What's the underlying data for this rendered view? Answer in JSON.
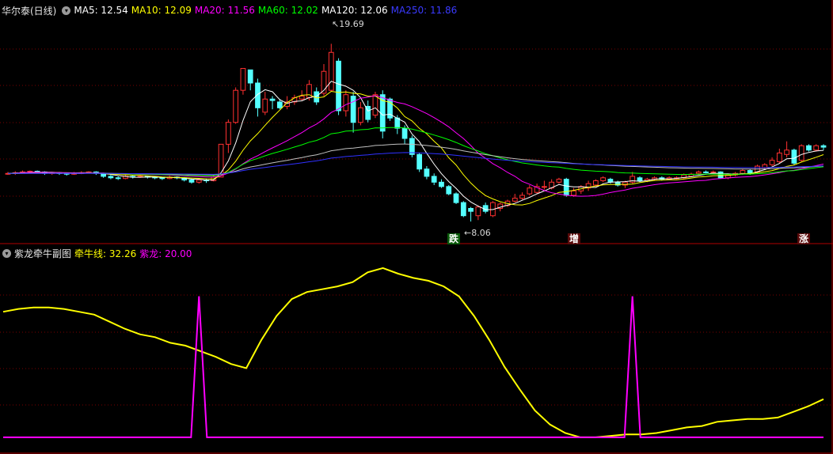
{
  "main_header": {
    "title": "华尔泰(日线)",
    "ma5": "MA5: 12.54",
    "ma10": "MA10: 12.09",
    "ma20": "MA20: 11.56",
    "ma60": "MA60: 12.02",
    "ma120": "MA120: 12.06",
    "ma250": "MA250: 11.86"
  },
  "sub_header": {
    "title": "紫龙牵牛副图",
    "qianniu": "牵牛线: 32.26",
    "zilong": "紫龙: 20.00"
  },
  "annotations": {
    "high": "19.69",
    "low": "8.06"
  },
  "signals": {
    "s1": "跌",
    "s2": "增",
    "s3": "涨"
  },
  "colors": {
    "ma5": "#ffffff",
    "ma10": "#ffff00",
    "ma20": "#ff00ff",
    "ma60": "#00ff00",
    "ma120": "#ffffff",
    "ma250": "#3030ff",
    "up": "#ff3030",
    "down": "#54ffff",
    "qianniu": "#ffff00",
    "zilong": "#ff00ff",
    "grid": "#7a0000"
  },
  "chart_data": [
    {
      "type": "candlestick",
      "series": [
        {
          "name": "MA5",
          "values": []
        },
        {
          "name": "MA10",
          "values": []
        },
        {
          "name": "MA20",
          "values": []
        },
        {
          "name": "MA60",
          "values": []
        },
        {
          "name": "MA120",
          "values": []
        },
        {
          "name": "MA250",
          "values": []
        }
      ],
      "annotations": [
        "19.69",
        "8.06"
      ],
      "ylim": [
        6.8,
        21.5
      ],
      "candles": [
        [
          10.8,
          10.8,
          10.9,
          10.7
        ],
        [
          10.8,
          10.85,
          10.95,
          10.7
        ],
        [
          10.85,
          10.9,
          11.0,
          10.8
        ],
        [
          10.9,
          10.95,
          11.0,
          10.85
        ],
        [
          10.95,
          10.9,
          11.0,
          10.8
        ],
        [
          10.9,
          10.8,
          10.95,
          10.7
        ],
        [
          10.8,
          10.85,
          10.9,
          10.7
        ],
        [
          10.85,
          10.8,
          10.9,
          10.7
        ],
        [
          10.8,
          10.75,
          10.85,
          10.65
        ],
        [
          10.75,
          10.8,
          10.9,
          10.7
        ],
        [
          10.8,
          10.85,
          10.95,
          10.75
        ],
        [
          10.85,
          10.9,
          10.95,
          10.8
        ],
        [
          10.9,
          10.8,
          10.95,
          10.7
        ],
        [
          10.8,
          10.6,
          10.85,
          10.5
        ],
        [
          10.6,
          10.5,
          10.7,
          10.4
        ],
        [
          10.5,
          10.45,
          10.6,
          10.35
        ],
        [
          10.45,
          10.6,
          10.7,
          10.4
        ],
        [
          10.6,
          10.55,
          10.7,
          10.45
        ],
        [
          10.55,
          10.6,
          10.7,
          10.5
        ],
        [
          10.6,
          10.55,
          10.65,
          10.45
        ],
        [
          10.55,
          10.5,
          10.6,
          10.4
        ],
        [
          10.5,
          10.45,
          10.55,
          10.35
        ],
        [
          10.45,
          10.55,
          10.65,
          10.4
        ],
        [
          10.55,
          10.5,
          10.6,
          10.4
        ],
        [
          10.5,
          10.35,
          10.55,
          10.25
        ],
        [
          10.35,
          10.2,
          10.45,
          10.1
        ],
        [
          10.2,
          10.35,
          10.45,
          10.1
        ],
        [
          10.35,
          10.3,
          10.45,
          10.15
        ],
        [
          10.3,
          10.55,
          10.7,
          10.25
        ],
        [
          10.55,
          12.8,
          12.8,
          12.1
        ],
        [
          12.8,
          14.3,
          14.5,
          12.2
        ],
        [
          14.3,
          16.5,
          16.7,
          14.2
        ],
        [
          16.5,
          18.0,
          18.0,
          16.2
        ],
        [
          17.9,
          17.0,
          17.9,
          16.5
        ],
        [
          17.0,
          15.3,
          17.3,
          14.7
        ],
        [
          15.0,
          15.9,
          16.4,
          14.8
        ],
        [
          15.9,
          15.8,
          16.1,
          15.2
        ],
        [
          15.7,
          15.3,
          15.9,
          15.2
        ],
        [
          15.4,
          15.7,
          16.1,
          15.2
        ],
        [
          15.7,
          16.0,
          16.2,
          15.5
        ],
        [
          15.9,
          16.1,
          16.5,
          15.8
        ],
        [
          16.0,
          16.9,
          17.2,
          15.8
        ],
        [
          16.4,
          15.7,
          16.7,
          15.5
        ],
        [
          16.3,
          17.8,
          18.3,
          16.1
        ],
        [
          16.5,
          19.1,
          19.69,
          16.4
        ],
        [
          18.5,
          15.1,
          18.7,
          14.8
        ],
        [
          15.1,
          16.2,
          16.5,
          14.7
        ],
        [
          16.1,
          14.3,
          16.4,
          13.6
        ],
        [
          14.3,
          15.3,
          15.7,
          14.1
        ],
        [
          15.4,
          14.5,
          15.8,
          14.3
        ],
        [
          14.8,
          16.2,
          16.4,
          14.6
        ],
        [
          16.2,
          13.7,
          16.5,
          13.2
        ],
        [
          15.9,
          14.6,
          16.0,
          14.4
        ],
        [
          14.6,
          13.9,
          14.8,
          13.5
        ],
        [
          13.9,
          13.2,
          14.1,
          12.8
        ],
        [
          13.2,
          12.1,
          13.4,
          11.9
        ],
        [
          12.1,
          11.1,
          12.2,
          10.9
        ],
        [
          11.1,
          10.6,
          11.3,
          10.4
        ],
        [
          10.6,
          10.2,
          10.8,
          10.0
        ],
        [
          10.2,
          9.9,
          10.4,
          9.8
        ],
        [
          9.9,
          9.4,
          10.0,
          9.3
        ],
        [
          9.4,
          8.8,
          9.5,
          8.7
        ],
        [
          8.8,
          7.9,
          8.9,
          7.8
        ],
        [
          8.4,
          8.2,
          8.5,
          7.5
        ],
        [
          7.9,
          8.5,
          8.6,
          7.6
        ],
        [
          8.6,
          8.2,
          8.8,
          8.06
        ],
        [
          7.9,
          8.8,
          8.9,
          7.8
        ],
        [
          8.4,
          8.7,
          8.8,
          8.2
        ],
        [
          8.6,
          8.9,
          9.0,
          8.5
        ],
        [
          8.9,
          9.1,
          9.4,
          8.8
        ],
        [
          9.1,
          9.3,
          9.5,
          9.0
        ],
        [
          9.4,
          9.8,
          10.0,
          9.3
        ],
        [
          9.5,
          9.9,
          10.1,
          9.4
        ],
        [
          9.9,
          9.9,
          10.3,
          9.7
        ],
        [
          9.8,
          10.2,
          10.4,
          9.7
        ],
        [
          10.2,
          10.4,
          10.5,
          10.1
        ],
        [
          10.4,
          9.3,
          10.5,
          9.2
        ],
        [
          9.3,
          9.6,
          9.8,
          9.2
        ],
        [
          9.6,
          9.9,
          10.0,
          9.4
        ],
        [
          9.8,
          10.1,
          10.3,
          9.6
        ],
        [
          10.0,
          10.3,
          10.4,
          9.9
        ],
        [
          10.3,
          10.5,
          10.6,
          10.2
        ],
        [
          10.4,
          10.2,
          10.5,
          10.1
        ],
        [
          10.2,
          10.0,
          10.3,
          9.9
        ],
        [
          10.0,
          10.2,
          10.3,
          9.8
        ],
        [
          10.2,
          10.6,
          10.9,
          10.1
        ],
        [
          10.5,
          10.3,
          10.6,
          10.2
        ],
        [
          10.3,
          10.4,
          10.5,
          10.2
        ],
        [
          10.4,
          10.5,
          10.6,
          10.3
        ],
        [
          10.5,
          10.4,
          10.6,
          10.3
        ],
        [
          10.4,
          10.5,
          10.6,
          10.35
        ],
        [
          10.5,
          10.5,
          10.6,
          10.4
        ],
        [
          10.5,
          10.7,
          10.8,
          10.4
        ],
        [
          10.6,
          10.75,
          10.85,
          10.55
        ],
        [
          10.8,
          10.9,
          11.0,
          10.7
        ],
        [
          10.9,
          10.85,
          11.0,
          10.8
        ],
        [
          10.85,
          10.9,
          11.0,
          10.8
        ],
        [
          10.9,
          10.5,
          10.95,
          10.45
        ],
        [
          10.5,
          10.7,
          10.8,
          10.4
        ],
        [
          10.7,
          10.8,
          10.9,
          10.6
        ],
        [
          10.8,
          11.0,
          11.1,
          10.7
        ],
        [
          11.0,
          10.8,
          11.1,
          10.7
        ],
        [
          10.9,
          11.3,
          11.4,
          10.8
        ],
        [
          11.2,
          11.4,
          11.5,
          11.1
        ],
        [
          11.4,
          11.7,
          11.9,
          11.3
        ],
        [
          11.6,
          12.2,
          12.5,
          11.5
        ],
        [
          12.1,
          12.4,
          13.0,
          11.9
        ],
        [
          12.4,
          11.5,
          12.5,
          11.4
        ],
        [
          11.7,
          12.7,
          12.8,
          11.6
        ],
        [
          12.7,
          12.4,
          12.8,
          12.3
        ],
        [
          12.4,
          12.7,
          12.8,
          12.3
        ],
        [
          12.7,
          12.6,
          12.8,
          12.4
        ]
      ]
    },
    {
      "type": "line",
      "series": [
        {
          "name": "牵牛线",
          "values": []
        },
        {
          "name": "紫龙",
          "values": []
        }
      ],
      "ylim": [
        -4,
        125
      ],
      "qianniu": [
        89,
        91,
        92,
        92,
        91,
        89,
        87,
        82,
        77,
        73,
        71,
        67,
        65,
        61,
        57,
        52,
        49,
        69,
        86,
        98,
        103,
        105,
        107,
        110,
        117,
        120,
        116,
        113,
        111,
        107,
        100,
        86,
        69,
        50,
        34,
        19,
        9,
        3,
        0,
        0,
        1,
        2,
        2,
        3,
        5,
        7,
        8,
        11,
        12,
        13,
        13,
        14,
        18,
        22,
        27
      ],
      "zilong_spikes": [
        26,
        85
      ]
    }
  ]
}
